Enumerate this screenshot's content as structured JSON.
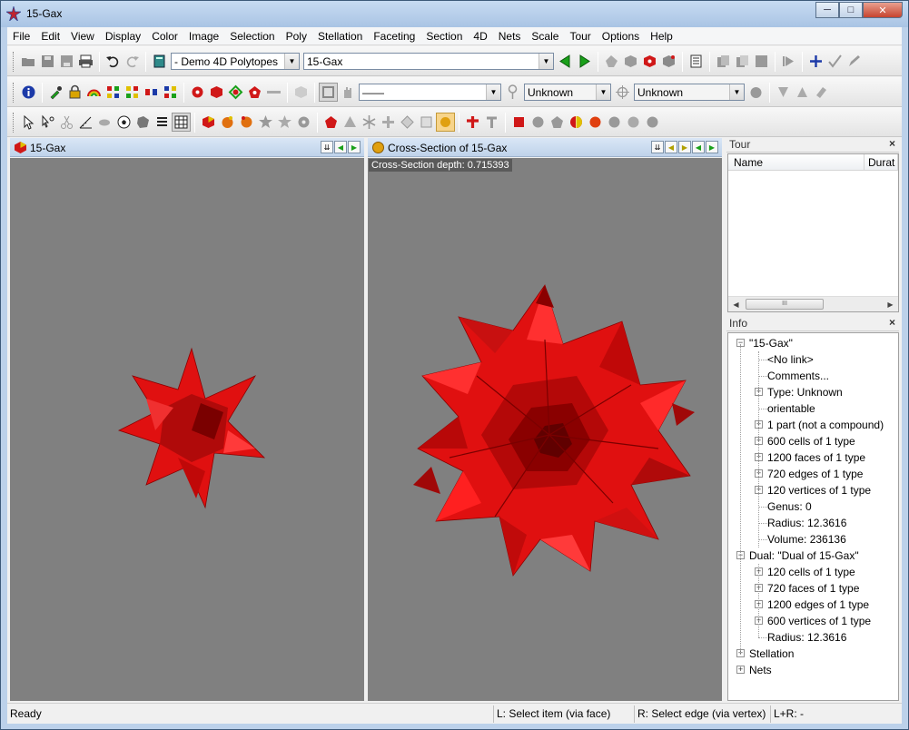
{
  "window": {
    "title": "15-Gax",
    "minimize": "─",
    "maximize": "□",
    "close": "✕"
  },
  "menu": [
    "File",
    "Edit",
    "View",
    "Display",
    "Color",
    "Image",
    "Selection",
    "Poly",
    "Stellation",
    "Faceting",
    "Section",
    "4D",
    "Nets",
    "Scale",
    "Tour",
    "Options",
    "Help"
  ],
  "toolbar1": {
    "category_select": "- Demo 4D Polytopes",
    "polytope_select": "15-Gax"
  },
  "toolbar2": {
    "line_select": "——",
    "select_a": "Unknown",
    "select_b": "Unknown"
  },
  "left_pane": {
    "title": "15-Gax"
  },
  "right_pane": {
    "title": "Cross-Section of 15-Gax",
    "depth_label": "Cross-Section depth: 0.715393"
  },
  "tour_panel": {
    "title": "Tour",
    "close": "×",
    "columns": [
      "Name",
      "Durat"
    ],
    "scroll_thumb": "III"
  },
  "info_panel": {
    "title": "Info",
    "close": "×",
    "items": [
      {
        "label": "\"15-Gax\"",
        "level": 0,
        "expander": "−"
      },
      {
        "label": "<No link>",
        "level": 1,
        "expander": ""
      },
      {
        "label": "Comments...",
        "level": 1,
        "expander": ""
      },
      {
        "label": "Type: Unknown",
        "level": 1,
        "expander": "+"
      },
      {
        "label": "orientable",
        "level": 1,
        "expander": ""
      },
      {
        "label": "1 part (not a compound)",
        "level": 1,
        "expander": "+"
      },
      {
        "label": "600 cells of 1 type",
        "level": 1,
        "expander": "+"
      },
      {
        "label": "1200 faces of 1 type",
        "level": 1,
        "expander": "+"
      },
      {
        "label": "720 edges of 1 type",
        "level": 1,
        "expander": "+"
      },
      {
        "label": "120 vertices of 1 type",
        "level": 1,
        "expander": "+"
      },
      {
        "label": "Genus: 0",
        "level": 1,
        "expander": ""
      },
      {
        "label": "Radius: 12.3616",
        "level": 1,
        "expander": ""
      },
      {
        "label": "Volume: 236136",
        "level": 1,
        "expander": ""
      },
      {
        "label": "Dual: \"Dual of 15-Gax\"",
        "level": 0,
        "expander": "−"
      },
      {
        "label": "120 cells of 1 type",
        "level": 1,
        "expander": "+"
      },
      {
        "label": "720 faces of 1 type",
        "level": 1,
        "expander": "+"
      },
      {
        "label": "1200 edges of 1 type",
        "level": 1,
        "expander": "+"
      },
      {
        "label": "600 vertices of 1 type",
        "level": 1,
        "expander": "+"
      },
      {
        "label": "Radius: 12.3616",
        "level": 1,
        "expander": ""
      },
      {
        "label": "Stellation",
        "level": 0,
        "expander": "+"
      },
      {
        "label": "Nets",
        "level": 0,
        "expander": "+"
      }
    ]
  },
  "status": {
    "ready": "Ready",
    "left_click": "L: Select item (via face)",
    "right_click": "R: Select edge (via vertex)",
    "both_click": "L+R: -"
  },
  "colors": {
    "polytope_red": "#e01010",
    "viewport_gray": "#808080",
    "accent_green": "#1aa01a"
  }
}
